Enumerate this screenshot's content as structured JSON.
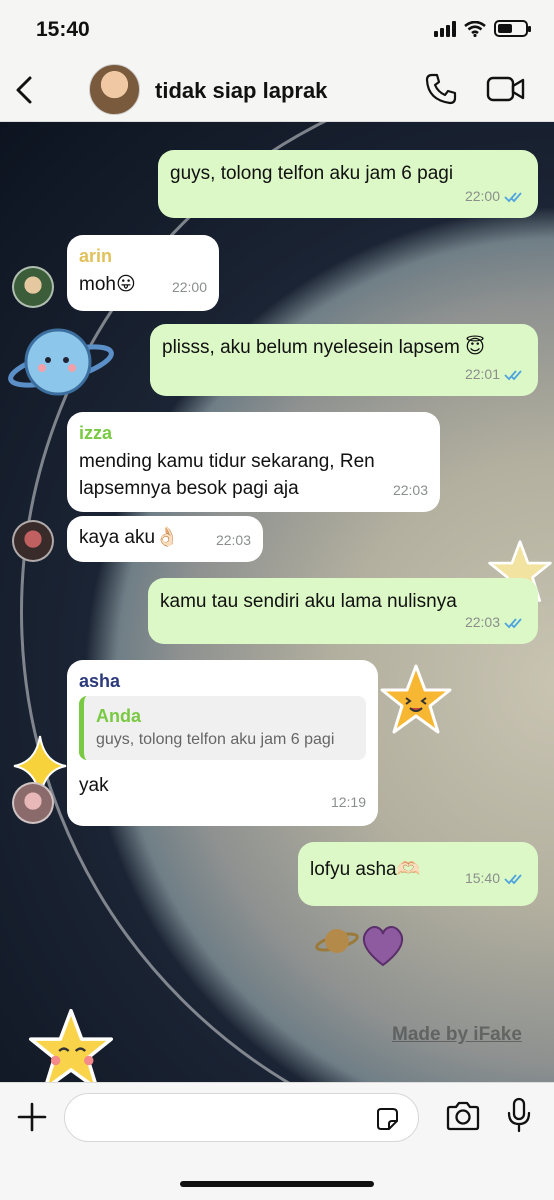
{
  "status_bar": {
    "time": "15:40"
  },
  "header": {
    "title": "tidak siap laprak",
    "icons": [
      "back-chevron-icon",
      "phone-icon",
      "video-camera-icon"
    ]
  },
  "messages": [
    {
      "type": "out",
      "text": "guys, tolong telfon aku jam 6 pagi",
      "time": "22:00",
      "read": true
    },
    {
      "type": "in",
      "sender": "arin",
      "sender_color": "#e0c15a",
      "text": "moh😛",
      "time": "22:00"
    },
    {
      "type": "out",
      "text": "plisss, aku belum nyelesein lapsem 😇",
      "time": "22:01",
      "read": true
    },
    {
      "type": "in",
      "sender": "izza",
      "sender_color": "#7ac943",
      "text": "mending kamu tidur sekarang, Ren lapsemnya besok pagi aja",
      "time": "22:03"
    },
    {
      "type": "in",
      "text": "kaya aku👌🏻",
      "time": "22:03"
    },
    {
      "type": "out",
      "text": "kamu tau sendiri aku lama nulisnya",
      "time": "22:03",
      "read": true
    },
    {
      "type": "in",
      "sender": "asha",
      "sender_color": "#2c3a7a",
      "quote": {
        "name": "Anda",
        "text": "guys, tolong telfon aku jam 6 pagi"
      },
      "text": "yak",
      "time": "12:19"
    },
    {
      "type": "out",
      "text": "lofyu asha🫶🏻",
      "time": "15:40",
      "read": true
    }
  ],
  "watermark": "Made by iFake",
  "input": {
    "placeholder": ""
  },
  "colors": {
    "outgoing": "#dcf8c6",
    "incoming": "#ffffff",
    "read_ticks": "#4fa3e0"
  }
}
